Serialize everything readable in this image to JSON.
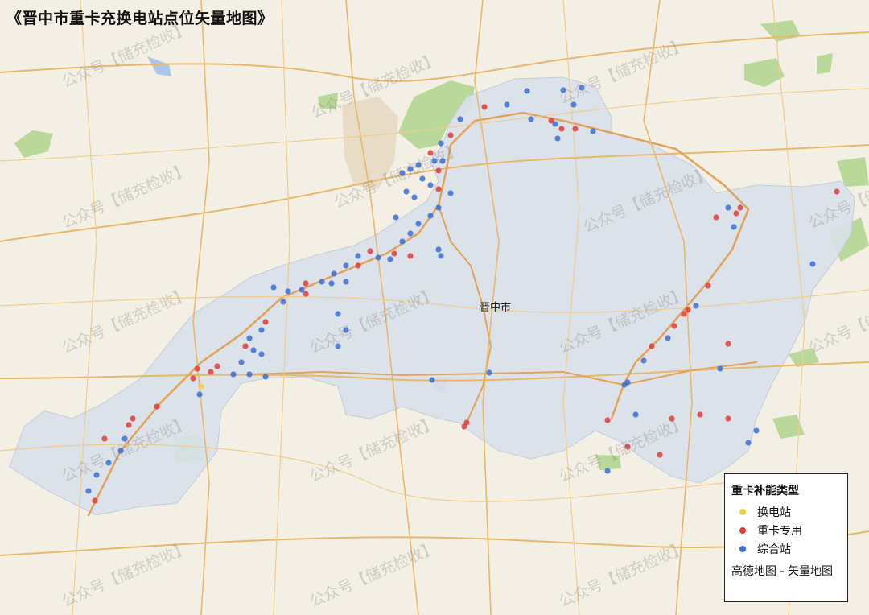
{
  "map": {
    "title": "《晋中市重卡充换电站点位矢量地图》",
    "city_label": "晋中市",
    "watermark_text": "公众号【储充检收】",
    "region_color": "#d8e0ea",
    "background_color": "#f3efe4"
  },
  "legend": {
    "title": "重卡补能类型",
    "items": [
      {
        "label": "换电站",
        "color": "#f0cf4a",
        "key": "swap"
      },
      {
        "label": "重卡专用",
        "color": "#e23b3b",
        "key": "truck"
      },
      {
        "label": "综合站",
        "color": "#3a6fd8",
        "key": "mixed"
      }
    ],
    "source": "高德地图 - 矢量地图"
  },
  "stations": {
    "swap_count_note": "",
    "colors": {
      "swap": "#f0cf4a",
      "truck": "#e23b3b",
      "mixed": "#3a6fd8"
    }
  }
}
